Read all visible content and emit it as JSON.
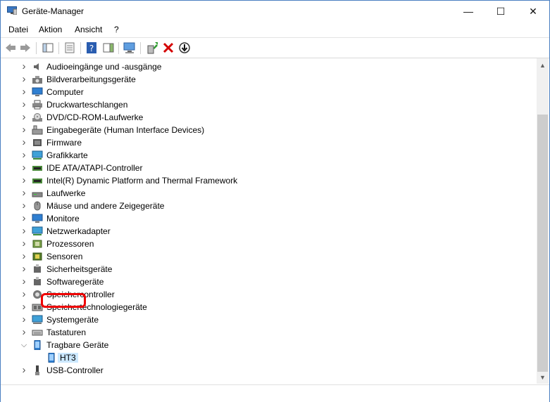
{
  "window": {
    "title": "Geräte-Manager"
  },
  "menu": {
    "items": [
      "Datei",
      "Aktion",
      "Ansicht",
      "?"
    ]
  },
  "tree": {
    "categories": [
      {
        "label": "Audioeingänge und -ausgänge",
        "icon": "speaker-icon",
        "expanded": false
      },
      {
        "label": "Bildverarbeitungsgeräte",
        "icon": "camera-icon",
        "expanded": false
      },
      {
        "label": "Computer",
        "icon": "computer-icon",
        "expanded": false
      },
      {
        "label": "Druckwarteschlangen",
        "icon": "printer-icon",
        "expanded": false
      },
      {
        "label": "DVD/CD-ROM-Laufwerke",
        "icon": "disc-drive-icon",
        "expanded": false
      },
      {
        "label": "Eingabegeräte (Human Interface Devices)",
        "icon": "hid-icon",
        "expanded": false
      },
      {
        "label": "Firmware",
        "icon": "firmware-icon",
        "expanded": false
      },
      {
        "label": "Grafikkarte",
        "icon": "display-adapter-icon",
        "expanded": false
      },
      {
        "label": "IDE ATA/ATAPI-Controller",
        "icon": "ide-controller-icon",
        "expanded": false
      },
      {
        "label": "Intel(R) Dynamic Platform and Thermal Framework",
        "icon": "thermal-icon",
        "expanded": false
      },
      {
        "label": "Laufwerke",
        "icon": "disk-drive-icon",
        "expanded": false
      },
      {
        "label": "Mäuse und andere Zeigegeräte",
        "icon": "mouse-icon",
        "expanded": false
      },
      {
        "label": "Monitore",
        "icon": "monitor-icon",
        "expanded": false
      },
      {
        "label": "Netzwerkadapter",
        "icon": "network-adapter-icon",
        "expanded": false
      },
      {
        "label": "Prozessoren",
        "icon": "processor-icon",
        "expanded": false
      },
      {
        "label": "Sensoren",
        "icon": "sensor-icon",
        "expanded": false
      },
      {
        "label": "Sicherheitsgeräte",
        "icon": "security-device-icon",
        "expanded": false
      },
      {
        "label": "Softwaregeräte",
        "icon": "software-device-icon",
        "expanded": false
      },
      {
        "label": "Speichercontroller",
        "icon": "storage-controller-icon",
        "expanded": false
      },
      {
        "label": "Speichertechnologiegeräte",
        "icon": "memory-technology-icon",
        "expanded": false
      },
      {
        "label": "Systemgeräte",
        "icon": "system-device-icon",
        "expanded": false
      },
      {
        "label": "Tastaturen",
        "icon": "keyboard-icon",
        "expanded": false
      },
      {
        "label": "Tragbare Geräte",
        "icon": "portable-device-icon",
        "expanded": true,
        "children": [
          {
            "label": "HT3",
            "icon": "phone-icon",
            "highlighted": true
          }
        ]
      },
      {
        "label": "USB-Controller",
        "icon": "usb-icon",
        "expanded": false
      }
    ]
  },
  "colors": {
    "accent_border": "#4a7fc1",
    "highlight_box": "#e00000",
    "selection": "#cce8ff"
  }
}
